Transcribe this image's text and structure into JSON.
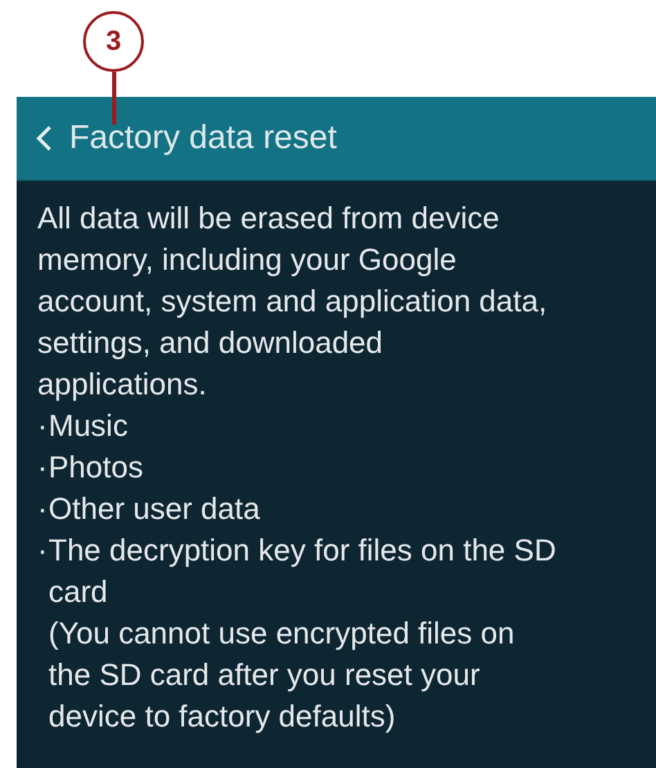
{
  "callout": {
    "label": "3"
  },
  "header": {
    "title": "Factory data reset"
  },
  "body": {
    "message": "All data will be erased from device\nmemory, including your Google\naccount, system and application data,\nsettings, and downloaded\napplications.",
    "items": [
      {
        "marker": "·",
        "text": "Music"
      },
      {
        "marker": "·",
        "text": "Photos"
      },
      {
        "marker": "·",
        "text": "Other user data"
      },
      {
        "marker": "·",
        "text": "The decryption key for files on the SD\ncard",
        "note": "(You cannot use encrypted files on\nthe SD card after you reset your\ndevice to factory defaults)"
      }
    ]
  }
}
